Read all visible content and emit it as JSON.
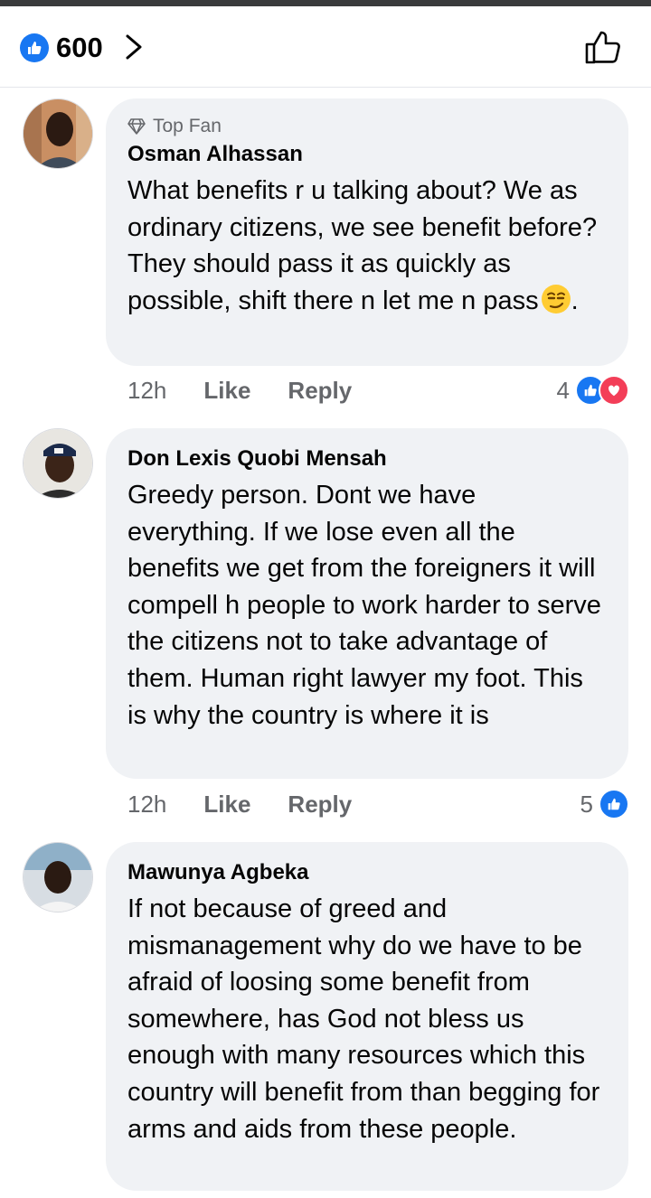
{
  "header": {
    "reaction_count": "600",
    "colors": {
      "like_blue": "#1877f2",
      "love_red": "#f33e58",
      "bubble": "#f0f2f5",
      "meta_gray": "#65676b"
    },
    "icons": [
      "like-reaction-icon",
      "chevron-right-icon",
      "thumbs-up-outline-icon"
    ]
  },
  "comments": [
    {
      "badge": "Top Fan",
      "author": "Osman Alhassan",
      "text": "What benefits r u talking about? We as ordinary citizens, we see benefit before? They should pass it as quickly as possible, shift there n let me n pass",
      "text_suffix": ".",
      "emoji": "smirking-face-emoji",
      "time": "12h",
      "like_label": "Like",
      "reply_label": "Reply",
      "reaction_count": "4",
      "reactions": [
        "like",
        "love"
      ]
    },
    {
      "author": "Don Lexis Quobi Mensah",
      "text": "Greedy person.  Dont we have everything. If we lose even all the benefits we get from the foreigners it will compell h people to work harder to serve the citizens not to take advantage of them. Human right lawyer my foot. This is why the country is where it is",
      "time": "12h",
      "like_label": "Like",
      "reply_label": "Reply",
      "reaction_count": "5",
      "reactions": [
        "like"
      ]
    },
    {
      "author": "Mawunya Agbeka",
      "text": "If not because of greed and mismanagement why do we have to be afraid of loosing some benefit from somewhere, has God not bless us enough with many resources which this country will benefit from than begging for arms and aids from these people."
    }
  ]
}
